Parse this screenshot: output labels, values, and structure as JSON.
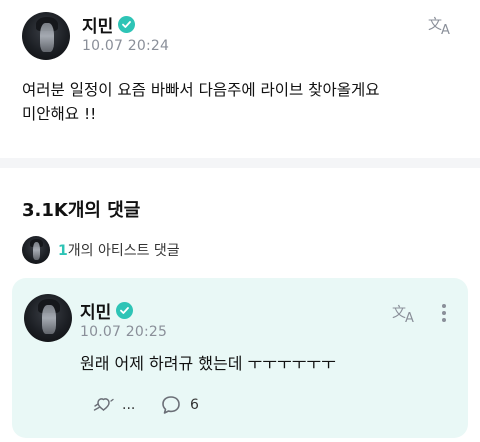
{
  "post": {
    "author": "지민",
    "date": "10.07 20:24",
    "body_line1": "여러분 일정이 요즘 바빠서 다음주에 라이브 찾아올게요",
    "body_line2": "미안해요 !!",
    "icons": {
      "translate": "translate-icon",
      "verified": "verified-icon"
    }
  },
  "comments": {
    "count_label": "3.1K개의 댓글",
    "artist_count": "1",
    "artist_label": "개의 아티스트 댓글"
  },
  "comment": {
    "author": "지민",
    "date": "10.07 20:25",
    "body": "원래 어제 하려규 했는데 ㅜㅜㅜㅜㅜㅜ",
    "reaction_label": "...",
    "reply_count": "6",
    "icons": {
      "reaction": "reaction-icon",
      "reply": "reply-icon",
      "more": "more-icon"
    }
  },
  "colors": {
    "accent": "#2ec4b6",
    "card_bg": "#e9f8f6",
    "muted": "#8a8f99"
  }
}
